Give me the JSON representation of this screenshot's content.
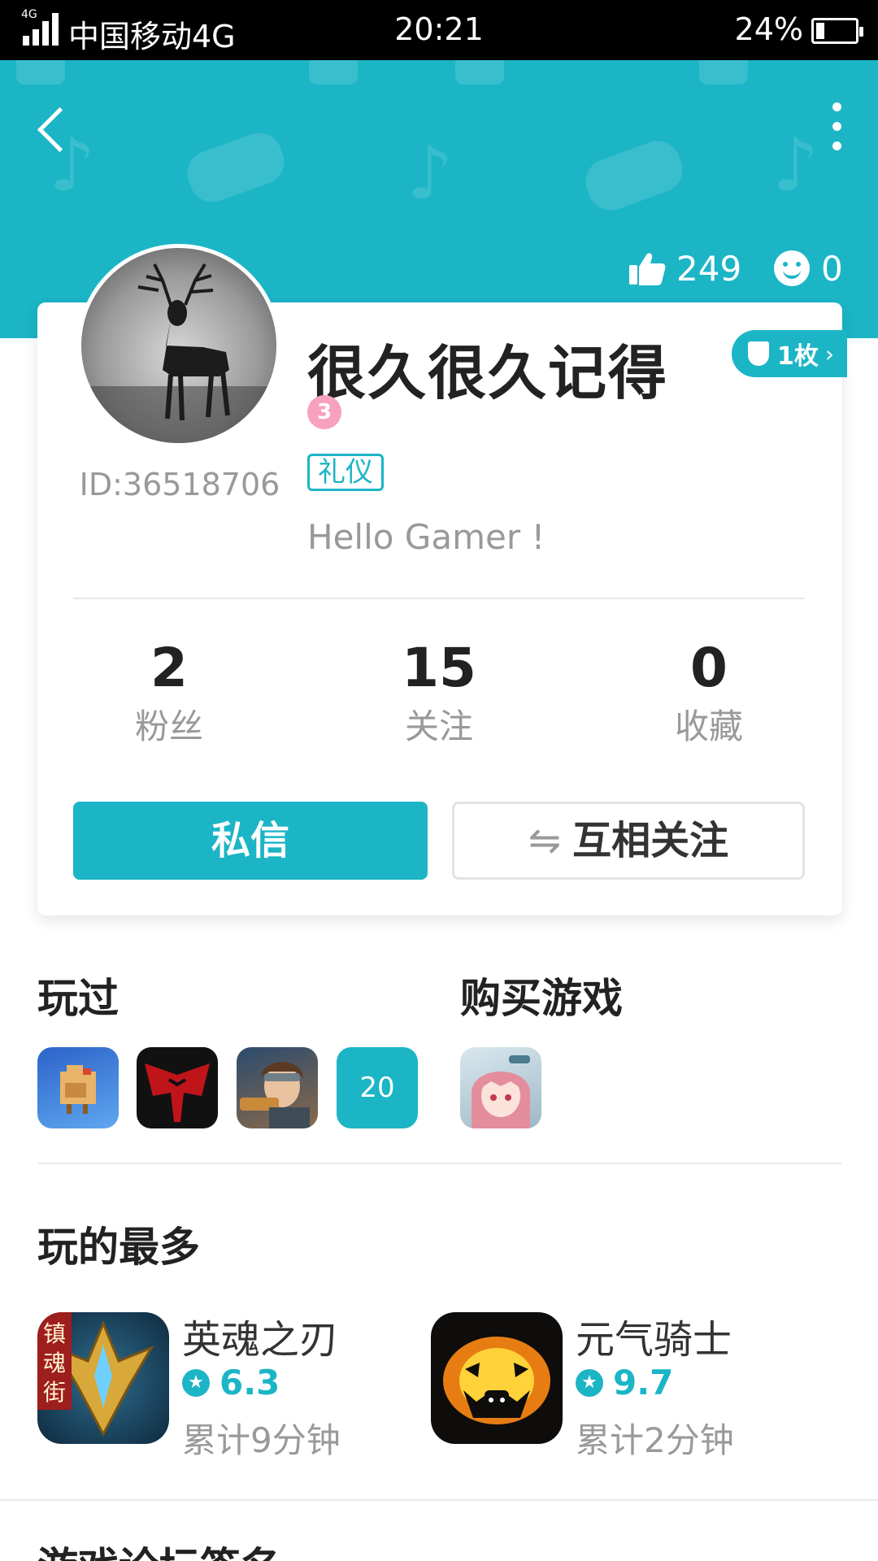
{
  "status_bar": {
    "network": "4G",
    "carrier": "中国移动4G",
    "time": "20:21",
    "battery": "24%"
  },
  "header": {
    "likes": "249",
    "smiles": "0",
    "icons": {
      "back": "back-chevron-icon",
      "more": "more-vertical-icon",
      "like": "thumbs-up-icon",
      "smile": "smiley-icon"
    },
    "color": "#1bb5c6"
  },
  "profile": {
    "username": "很久很久记得",
    "user_id": "ID:36518706",
    "level": "3",
    "tag": "礼仪",
    "bio": "Hello Gamer !",
    "medal_count": "1枚",
    "stats": [
      {
        "value": "2",
        "label": "粉丝"
      },
      {
        "value": "15",
        "label": "关注"
      },
      {
        "value": "0",
        "label": "收藏"
      }
    ],
    "message_button": "私信",
    "mutual_follow_button": "互相关注",
    "mutual_follow_icon": "⇋"
  },
  "played": {
    "title": "玩过",
    "count": "20"
  },
  "purchased": {
    "title": "购买游戏"
  },
  "most_played": {
    "title": "玩的最多",
    "games": [
      {
        "name": "英魂之刃",
        "rating": "6.3",
        "playtime": "累计9分钟",
        "icon_text": "镇魂街"
      },
      {
        "name": "元气骑士",
        "rating": "9.7",
        "playtime": "累计2分钟"
      }
    ]
  },
  "next_section_title": "游戏论坛签名"
}
